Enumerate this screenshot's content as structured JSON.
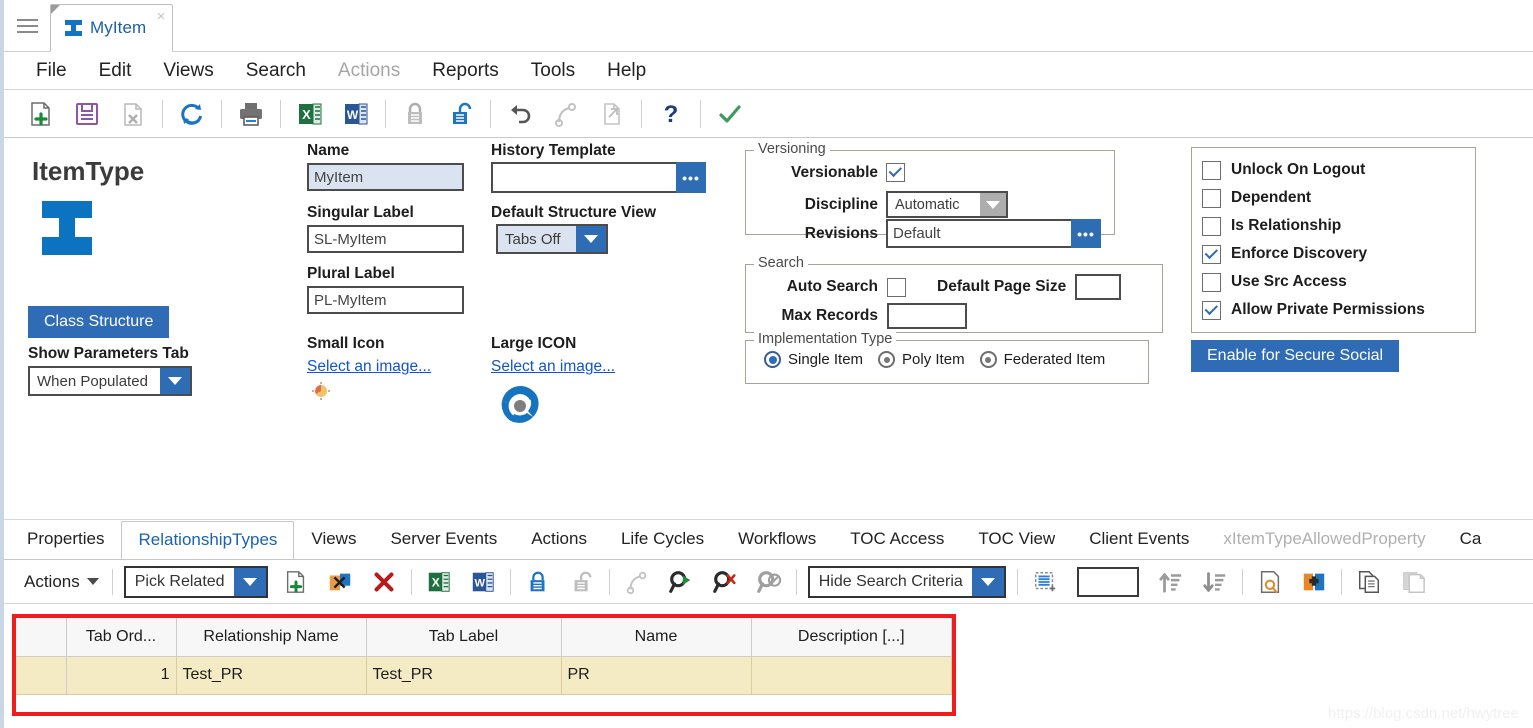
{
  "window": {
    "menu_icon": "hamburger-icon",
    "tab": {
      "label": "MyItem",
      "icon": "itemtype-ibeam-icon",
      "close": "×"
    }
  },
  "menubar": {
    "items": [
      {
        "label": "File",
        "disabled": false
      },
      {
        "label": "Edit",
        "disabled": false
      },
      {
        "label": "Views",
        "disabled": false
      },
      {
        "label": "Search",
        "disabled": false
      },
      {
        "label": "Actions",
        "disabled": true
      },
      {
        "label": "Reports",
        "disabled": false
      },
      {
        "label": "Tools",
        "disabled": false
      },
      {
        "label": "Help",
        "disabled": false
      }
    ]
  },
  "toolbar": {
    "buttons": [
      {
        "name": "new-item-icon",
        "title": "New"
      },
      {
        "name": "save-icon",
        "title": "Save"
      },
      {
        "name": "delete-icon",
        "title": "Delete"
      },
      {
        "name": "refresh-icon",
        "title": "Refresh"
      },
      {
        "name": "print-icon",
        "title": "Print"
      },
      {
        "name": "export-excel-icon",
        "title": "Export to Excel"
      },
      {
        "name": "export-word-icon",
        "title": "Export to Word"
      },
      {
        "name": "lock-icon",
        "title": "Lock"
      },
      {
        "name": "unlock-icon",
        "title": "Unlock"
      },
      {
        "name": "undo-icon",
        "title": "Undo"
      },
      {
        "name": "redo-icon",
        "title": "Redo"
      },
      {
        "name": "copy-item-icon",
        "title": "Copy"
      },
      {
        "name": "help-icon",
        "title": "Help"
      },
      {
        "name": "done-check-icon",
        "title": "Done"
      }
    ]
  },
  "form": {
    "heading": "ItemType",
    "class_structure_button": "Class Structure",
    "show_parameters_tab_label": "Show Parameters Tab",
    "show_parameters_tab_value": "When Populated",
    "name_label": "Name",
    "name_value": "MyItem",
    "singular_label_label": "Singular Label",
    "singular_label_value": "SL-MyItem",
    "plural_label_label": "Plural Label",
    "plural_label_value": "PL-MyItem",
    "small_icon_label": "Small Icon",
    "small_icon_link": "Select an image...",
    "history_template_label": "History Template",
    "history_template_value": "",
    "default_structure_view_label": "Default Structure View",
    "default_structure_view_value": "Tabs Off",
    "large_icon_label": "Large ICON",
    "large_icon_link": "Select an image...",
    "pick_button_glyph": "•••"
  },
  "versioning": {
    "title": "Versioning",
    "versionable_label": "Versionable",
    "versionable_checked": true,
    "discipline_label": "Discipline",
    "discipline_value": "Automatic",
    "revisions_label": "Revisions",
    "revisions_value": "Default"
  },
  "search": {
    "title": "Search",
    "auto_search_label": "Auto Search",
    "auto_search_checked": false,
    "default_page_size_label": "Default Page Size",
    "default_page_size_value": "",
    "max_records_label": "Max Records",
    "max_records_value": ""
  },
  "implementation_type": {
    "title": "Implementation Type",
    "options": [
      {
        "label": "Single Item",
        "selected": true
      },
      {
        "label": "Poly Item",
        "selected": false
      },
      {
        "label": "Federated Item",
        "selected": false
      }
    ]
  },
  "flags": {
    "items": [
      {
        "label": "Unlock On Logout",
        "checked": false
      },
      {
        "label": "Dependent",
        "checked": false
      },
      {
        "label": "Is Relationship",
        "checked": false
      },
      {
        "label": "Enforce Discovery",
        "checked": true
      },
      {
        "label": "Use Src Access",
        "checked": false
      },
      {
        "label": "Allow Private Permissions",
        "checked": true
      }
    ],
    "secure_social_button": "Enable for Secure Social"
  },
  "bottom_tabs": {
    "items": [
      {
        "label": "Properties",
        "active": false,
        "dim": false
      },
      {
        "label": "RelationshipTypes",
        "active": true,
        "dim": false
      },
      {
        "label": "Views",
        "active": false,
        "dim": false
      },
      {
        "label": "Server Events",
        "active": false,
        "dim": false
      },
      {
        "label": "Actions",
        "active": false,
        "dim": false
      },
      {
        "label": "Life Cycles",
        "active": false,
        "dim": false
      },
      {
        "label": "Workflows",
        "active": false,
        "dim": false
      },
      {
        "label": "TOC Access",
        "active": false,
        "dim": false
      },
      {
        "label": "TOC View",
        "active": false,
        "dim": false
      },
      {
        "label": "Client Events",
        "active": false,
        "dim": false
      },
      {
        "label": "xItemTypeAllowedProperty",
        "active": false,
        "dim": true
      },
      {
        "label": "Ca",
        "active": false,
        "dim": false
      }
    ]
  },
  "grid_toolbar": {
    "actions_label": "Actions",
    "pick_related_value": "Pick Related",
    "hide_search_criteria_value": "Hide Search Criteria",
    "page_size_value": "",
    "buttons": [
      {
        "name": "create-relationship-icon"
      },
      {
        "name": "pick-related-item-icon"
      },
      {
        "name": "delete-relationship-icon"
      },
      {
        "name": "export-excel-icon"
      },
      {
        "name": "export-word-icon"
      },
      {
        "name": "lock-icon"
      },
      {
        "name": "unlock-icon"
      },
      {
        "name": "redo-icon"
      },
      {
        "name": "run-search-icon"
      },
      {
        "name": "clear-search-icon"
      },
      {
        "name": "disable-search-icon"
      },
      {
        "name": "insert-row-icon"
      },
      {
        "name": "sort-ascending-icon"
      },
      {
        "name": "sort-descending-icon"
      },
      {
        "name": "search-page-icon"
      },
      {
        "name": "add-puzzle-icon"
      },
      {
        "name": "copy-icon"
      },
      {
        "name": "paste-icon"
      }
    ]
  },
  "grid": {
    "columns": [
      "",
      "Tab Ord...",
      "Relationship Name",
      "Tab Label",
      "Name",
      "Description [...]"
    ],
    "rows": [
      {
        "cells": [
          "",
          "1",
          "Test_PR",
          "Test_PR",
          "PR",
          ""
        ]
      }
    ]
  },
  "watermark": "https://blog.csdn.net/hwytree",
  "colors": {
    "accent_blue": "#2f6cb5",
    "icon_blue": "#0c73c0",
    "grid_row": "#f4ebc4",
    "highlight_border": "#ef1d1d",
    "selected_field": "#dae3ef"
  }
}
